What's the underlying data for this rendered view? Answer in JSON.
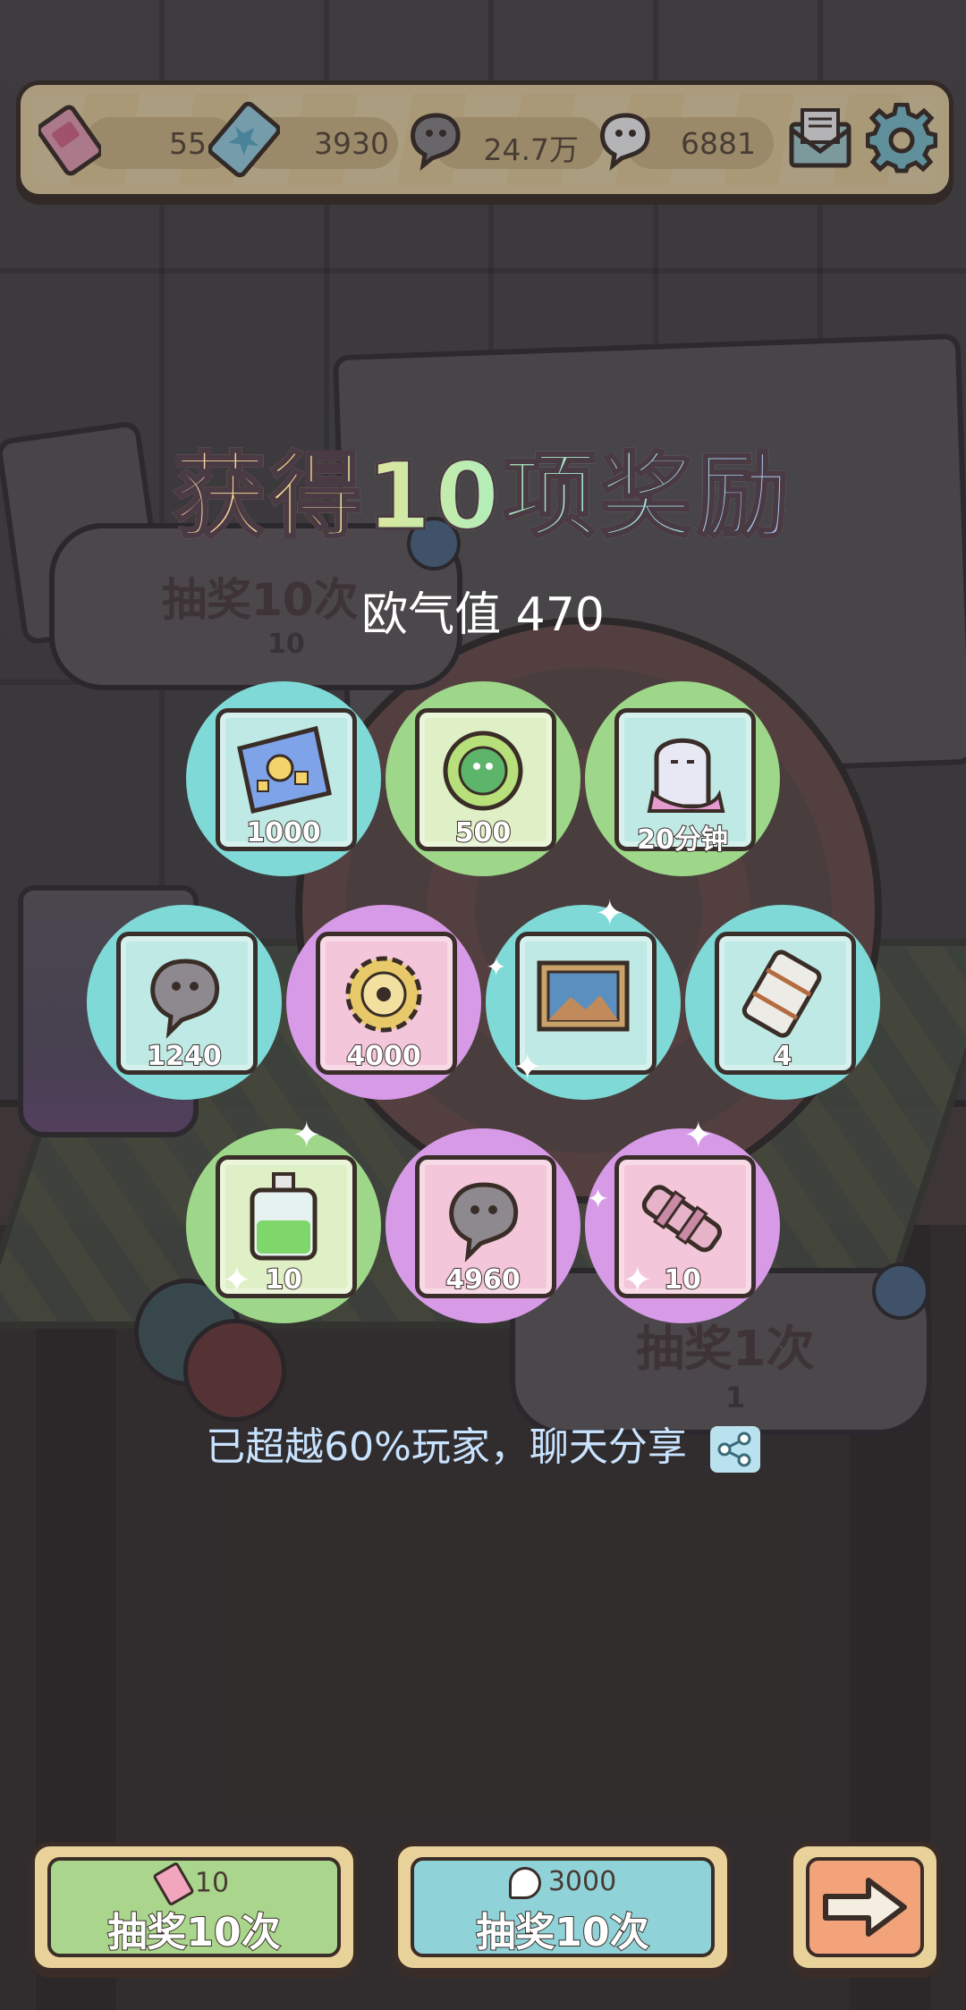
{
  "resources": [
    {
      "icon": "ticket-pink-icon",
      "value": "55"
    },
    {
      "icon": "ticket-blue-icon",
      "value": "3930"
    },
    {
      "icon": "gray-spirit-icon",
      "value": "24.7万"
    },
    {
      "icon": "white-spirit-icon",
      "value": "6881"
    }
  ],
  "header_icons": {
    "mail": "mail-icon",
    "settings": "gear-icon"
  },
  "background": {
    "bubble_left_title": "抽奖10次",
    "bubble_left_cost": "10",
    "bubble_right_title": "抽奖1次",
    "bubble_right_cost": "1"
  },
  "title": "获得10项奖励",
  "luck_label": "欧气值 470",
  "rewards": [
    {
      "item": "blueprint",
      "qty": "1000",
      "ring": "cyan",
      "card": "cyan"
    },
    {
      "item": "glowing-orb",
      "qty": "500",
      "ring": "green",
      "card": "green"
    },
    {
      "item": "ghost-costume",
      "qty": "20分钟",
      "ring": "green",
      "card": "cyan"
    },
    {
      "item": "gray-spirit",
      "qty": "1240",
      "ring": "cyan",
      "card": "cyan"
    },
    {
      "item": "gear-badge",
      "qty": "4000",
      "ring": "purple",
      "card": "pink"
    },
    {
      "item": "painting",
      "qty": "",
      "ring": "cyan",
      "card": "cyan"
    },
    {
      "item": "scroll",
      "qty": "4",
      "ring": "cyan",
      "card": "cyan"
    },
    {
      "item": "potion",
      "qty": "10",
      "ring": "green",
      "card": "green"
    },
    {
      "item": "gray-spirit",
      "qty": "4960",
      "ring": "purple",
      "card": "pink"
    },
    {
      "item": "telescope",
      "qty": "10",
      "ring": "purple",
      "card": "pink"
    }
  ],
  "share_text": "已超越60%玩家，聊天分享",
  "buttons": [
    {
      "cost": "10",
      "cost_icon": "ticket-pink-icon",
      "label": "抽奖10次",
      "color": "#a9d68c"
    },
    {
      "cost": "3000",
      "cost_icon": "white-spirit-icon",
      "label": "抽奖10次",
      "color": "#8fd3d9"
    },
    {
      "label": "",
      "icon": "arrow-right-icon",
      "color": "#f3a37a"
    }
  ]
}
